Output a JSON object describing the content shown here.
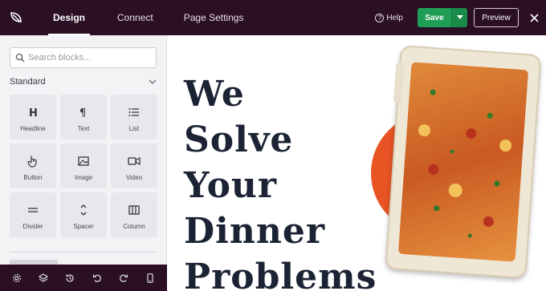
{
  "colors": {
    "topbar_bg": "#2b0f24",
    "save_green": "#1f9d55",
    "accent_orange": "#e85424",
    "headline_navy": "#1b2334"
  },
  "header": {
    "logo_icon": "seedprod-leaf-icon",
    "tabs": [
      {
        "label": "Design",
        "active": true
      },
      {
        "label": "Connect",
        "active": false
      },
      {
        "label": "Page Settings",
        "active": false
      }
    ],
    "help_label": "Help",
    "save_label": "Save",
    "preview_label": "Preview",
    "close_icon": "close-icon"
  },
  "sidebar": {
    "search_placeholder": "Search blocks...",
    "section_title": "Standard",
    "blocks": [
      {
        "label": "Headline",
        "icon": "heading-icon"
      },
      {
        "label": "Text",
        "icon": "paragraph-icon"
      },
      {
        "label": "List",
        "icon": "list-icon"
      },
      {
        "label": "Button",
        "icon": "pointer-hand-icon"
      },
      {
        "label": "Image",
        "icon": "image-icon"
      },
      {
        "label": "Video",
        "icon": "video-camera-icon"
      },
      {
        "label": "Divider",
        "icon": "divider-icon"
      },
      {
        "label": "Spacer",
        "icon": "spacer-icon"
      },
      {
        "label": "Column",
        "icon": "columns-icon"
      }
    ],
    "bottom_tools": [
      "settings-icon",
      "layers-icon",
      "history-icon",
      "undo-icon",
      "redo-icon",
      "mobile-preview-icon"
    ]
  },
  "canvas": {
    "headline_lines": [
      "We",
      "Solve",
      "Your",
      "Dinner",
      "Problems"
    ]
  }
}
